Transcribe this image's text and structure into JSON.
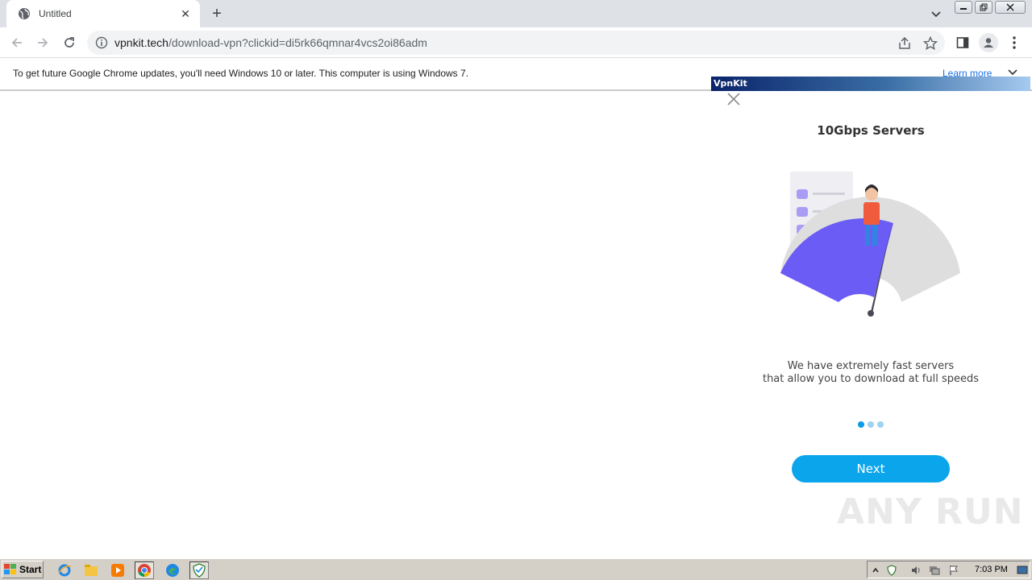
{
  "browser": {
    "tab": {
      "title": "Untitled",
      "favicon": "globe-icon",
      "close": "✕"
    },
    "new_tab": "+",
    "url": {
      "domain": "vpnkit.tech",
      "path": "/download-vpn?clickid=di5rk66qmnar4vcs2oi86adm"
    }
  },
  "infobar": {
    "message": "To get future Google Chrome updates, you'll need Windows 10 or later. This computer is using Windows 7.",
    "learn_more": "Learn more"
  },
  "popup": {
    "title": "VpnKit",
    "heading": "10Gbps Servers",
    "description_line1": "We have extremely fast servers",
    "description_line2": "that allow you to download at full speeds",
    "dots": {
      "total": 3,
      "active_index": 0
    },
    "next_label": "Next",
    "colors": {
      "accent": "#0ba5ec",
      "gauge": "#6a5cf5"
    }
  },
  "watermark": "ANY RUN",
  "taskbar": {
    "start_label": "Start",
    "clock": "7:03 PM"
  }
}
